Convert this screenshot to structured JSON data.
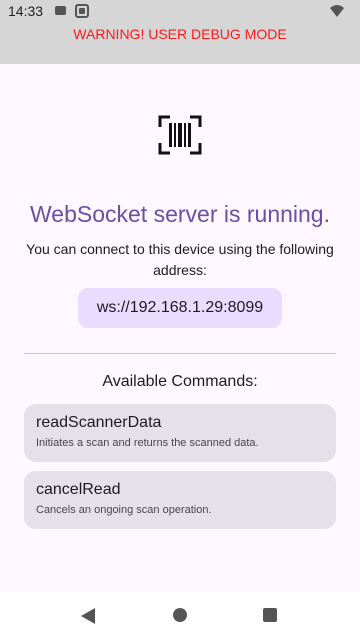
{
  "status_bar": {
    "time": "14:33",
    "icons": [
      "notification-icon",
      "app-icon-status",
      "wifi-icon"
    ]
  },
  "debug_banner": "WARNING! USER DEBUG MODE",
  "header": {
    "icon": "barcode-scanner-icon",
    "title": "WebSocket server is running.",
    "subtitle": "You can connect to this device using the following address:",
    "address": "ws://192.168.1.29:8099"
  },
  "commands": {
    "heading": "Available Commands:",
    "items": [
      {
        "name": "readScannerData",
        "description": "Initiates a scan and returns the scanned data."
      },
      {
        "name": "cancelRead",
        "description": "Cancels an ongoing scan operation."
      }
    ]
  },
  "nav": {
    "icons": [
      "back-icon",
      "home-icon",
      "recents-icon"
    ]
  },
  "colors": {
    "accent": "#6a4fa3",
    "warning": "#ff1a1a",
    "chip": "#e8ddff",
    "card": "#e6e0e9"
  }
}
